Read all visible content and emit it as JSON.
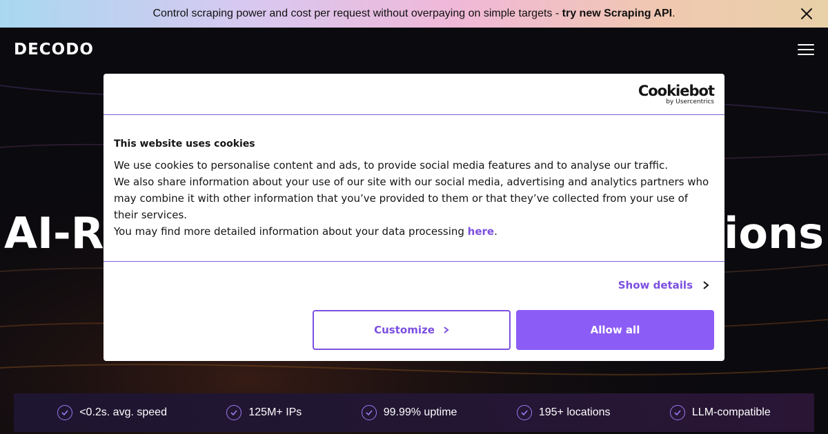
{
  "announcement": {
    "text": "Control scraping power and cost per request without overpaying on simple targets - ",
    "link": "try new Scraping API",
    "suffix": "."
  },
  "header": {
    "logo": "DECODO"
  },
  "hero": {
    "title_left": "AI-R",
    "title_right": "tions"
  },
  "stats": [
    {
      "label": "<0.2s. avg. speed"
    },
    {
      "label": "125M+ IPs"
    },
    {
      "label": "99.99% uptime"
    },
    {
      "label": "195+ locations"
    },
    {
      "label": "LLM-compatible"
    }
  ],
  "cookie_modal": {
    "brand": "Cookiebot",
    "brand_sub": "by Usercentrics",
    "title": "This website uses cookies",
    "line1": "We use cookies to personalise content and ads, to provide social media features and to analyse our traffic.",
    "line2": "We also share information about your use of our site with our social media, advertising and analytics partners who may combine it with other information that you’ve provided to them or that they’ve collected from your use of their services.",
    "line3": "You may find more detailed information about your data processing ",
    "line3_link": "here",
    "line3_end": ".",
    "show_details": "Show details",
    "customize": "Customize",
    "allow_all": "Allow all"
  },
  "colors": {
    "accent": "#8c5cf6",
    "link": "#7b4fe0",
    "background": "#0b0a0e"
  }
}
